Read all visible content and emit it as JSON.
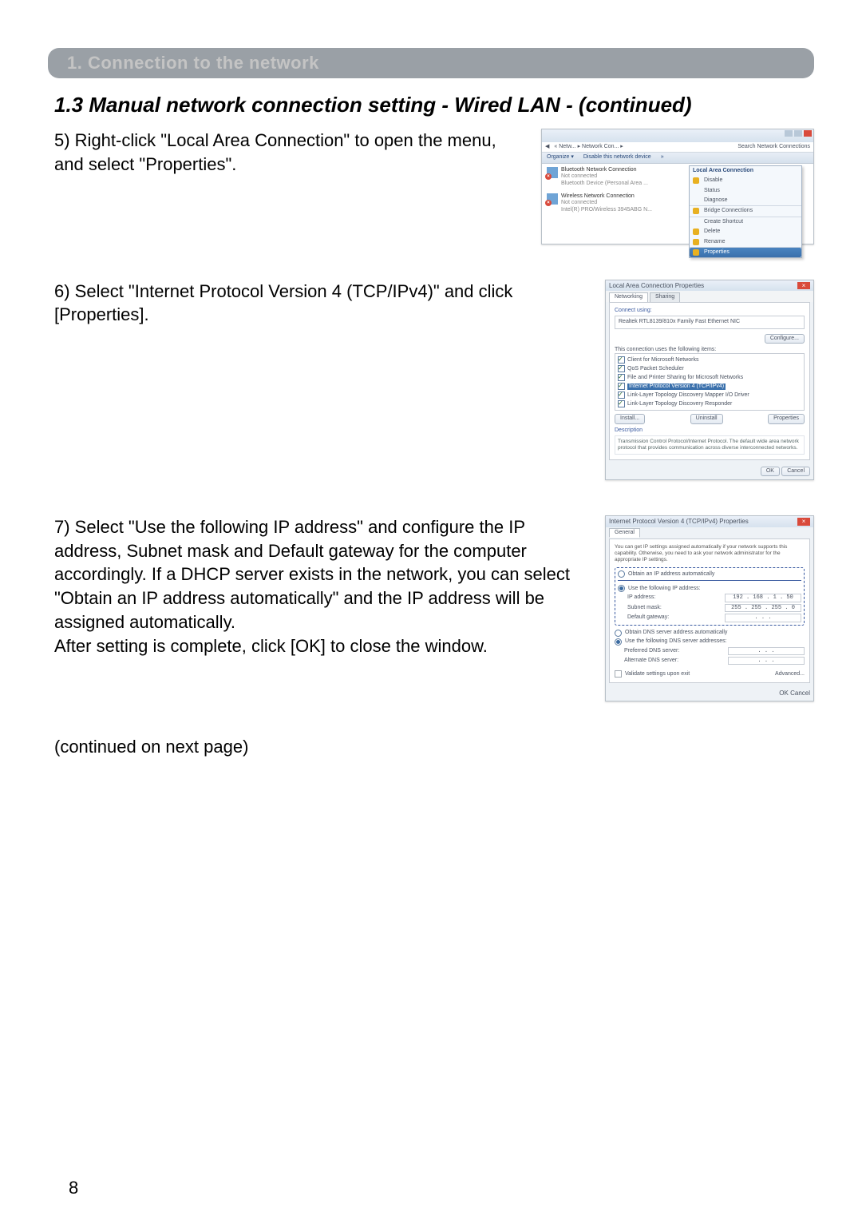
{
  "page_number": "8",
  "section_bar": "1. Connection to the network",
  "subsection": "1.3 Manual network connection setting - Wired LAN - (continued)",
  "steps": {
    "s5": "5) Right-click \"Local Area Connection\" to open the menu, and select \"Properties\".",
    "s6": "6) Select \"Internet Protocol Version 4 (TCP/IPv4)\" and click [Properties].",
    "s7": "7) Select \"Use the following IP address\" and configure the IP address, Subnet mask and Default gateway for the computer accordingly. If a DHCP server exists in the network, you can select \"Obtain an IP address automatically\" and the IP address will be assigned automatically.\nAfter setting is complete, click [OK] to close the window."
  },
  "continued": "(continued on next page)",
  "shot1": {
    "breadcrumb": "« Netw... ▸ Network Con... ▸",
    "search_ph": "Search Network Connections",
    "toolbar": {
      "org": "Organize ▾",
      "disable": "Disable this network device",
      "more": "»"
    },
    "conn_bt": {
      "name": "Bluetooth Network Connection",
      "status": "Not connected",
      "dev": "Bluetooth Device (Personal Area ..."
    },
    "conn_wifi": {
      "name": "Wireless Network Connection",
      "status": "Not connected",
      "dev": "Intel(R) PRO/Wireless 3945ABG N..."
    },
    "ctx_header": "Local Area Connection",
    "ctx_items": {
      "disable": "Disable",
      "status": "Status",
      "diagnose": "Diagnose",
      "bridge": "Bridge Connections",
      "shortcut": "Create Shortcut",
      "delete": "Delete",
      "rename": "Rename",
      "properties": "Properties"
    }
  },
  "shot2": {
    "title": "Local Area Connection Properties",
    "tab_net": "Networking",
    "tab_share": "Sharing",
    "connect_using_lbl": "Connect using:",
    "adapter": "Realtek RTL8139/810x Family Fast Ethernet NIC",
    "configure": "Configure...",
    "list_label": "This connection uses the following items:",
    "items": {
      "client": "Client for Microsoft Networks",
      "qos": "QoS Packet Scheduler",
      "fps": "File and Printer Sharing for Microsoft Networks",
      "ipv4": "Internet Protocol Version 4 (TCP/IPv4)",
      "lltdm": "Link-Layer Topology Discovery Mapper I/O Driver",
      "lltdr": "Link-Layer Topology Discovery Responder"
    },
    "btn_install": "Install...",
    "btn_uninstall": "Uninstall",
    "btn_props": "Properties",
    "desc_label": "Description",
    "desc": "Transmission Control Protocol/Internet Protocol. The default wide area network protocol that provides communication across diverse interconnected networks.",
    "ok": "OK",
    "cancel": "Cancel"
  },
  "shot3": {
    "title": "Internet Protocol Version 4 (TCP/IPv4) Properties",
    "tab_general": "General",
    "descr": "You can get IP settings assigned automatically if your network supports this capability. Otherwise, you need to ask your network administrator for the appropriate IP settings.",
    "r_obtain_ip": "Obtain an IP address automatically",
    "r_use_ip": "Use the following IP address:",
    "lbl_ip": "IP address:",
    "val_ip": "192 . 168 .  1  . 50",
    "lbl_mask": "Subnet mask:",
    "val_mask": "255 . 255 . 255 .  0",
    "lbl_gw": "Default gateway:",
    "val_gw": " .       .       .   ",
    "r_obtain_dns": "Obtain DNS server address automatically",
    "r_use_dns": "Use the following DNS server addresses:",
    "lbl_pdns": "Preferred DNS server:",
    "val_pdns": " .       .       .   ",
    "lbl_adns": "Alternate DNS server:",
    "val_adns": " .       .       .   ",
    "validate": "Validate settings upon exit",
    "advanced": "Advanced...",
    "ok": "OK",
    "cancel": "Cancel"
  }
}
